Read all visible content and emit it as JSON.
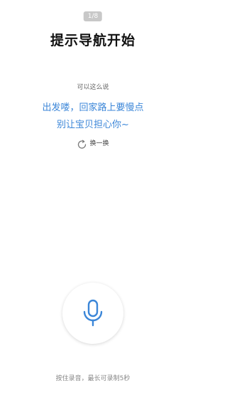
{
  "pager": {
    "label": "1/8"
  },
  "title": "提示导航开始",
  "hint": "可以这么说",
  "samples": [
    "出发喽，回家路上要慢点",
    "别让宝贝担心你~"
  ],
  "refresh": {
    "label": "换一换",
    "icon": "refresh-icon"
  },
  "mic": {
    "icon": "microphone-icon",
    "color": "#3b86d8"
  },
  "footer": {
    "hint": "按住录音，最长可录制5秒"
  }
}
